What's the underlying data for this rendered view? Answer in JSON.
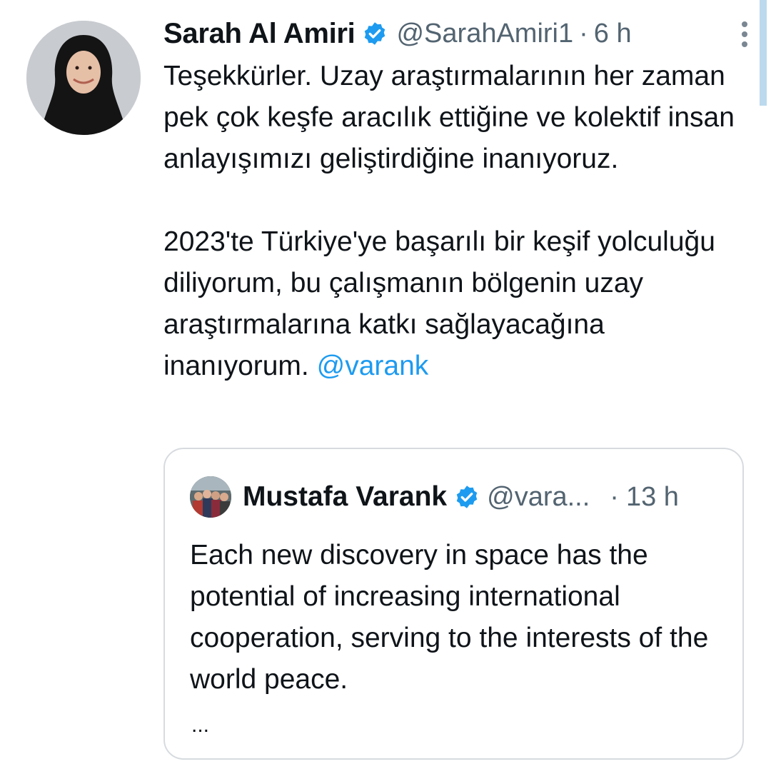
{
  "tweet": {
    "author_name": "Sarah Al Amiri",
    "handle": "@SarahAmiri1",
    "separator": "·",
    "time": "6 h",
    "text_para1": "Teşekkürler. Uzay araştırmalarının her zaman pek çok keşfe aracılık ettiğine ve kolektif insan anlayışımızı geliştirdiğine inanıyoruz.",
    "text_para2": "2023'te Türkiye'ye başarılı bir keşif yolculuğu diliyorum, bu çalışmanın bölgenin uzay araştırmalarına katkı sağlayacağına inanıyorum.",
    "mention": "@varank",
    "verified_icon": "verified-badge-icon",
    "more_icon": "vertical-dots-icon"
  },
  "quoted_tweet": {
    "author_name": "Mustafa Varank",
    "handle": "@vara...",
    "separator": "·",
    "time": "13 h",
    "text": "Each new discovery in space has the potential of increasing international cooperation, serving to the interests of the world peace.",
    "ellipsis": "..."
  },
  "colors": {
    "accent": "#1d9bf0",
    "text": "#0f1419",
    "secondary": "#536471",
    "border": "#d7dbdf"
  }
}
